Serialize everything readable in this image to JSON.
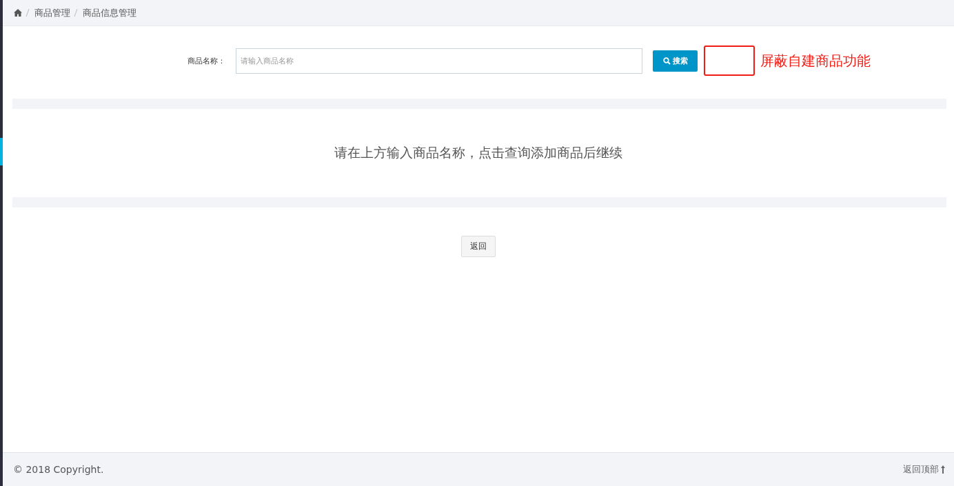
{
  "breadcrumb": [
    "商品管理",
    "商品信息管理"
  ],
  "search": {
    "label": "商品名称：",
    "placeholder": "请输入商品名称",
    "button": "搜索"
  },
  "annotation": {
    "text": "屏蔽自建商品功能"
  },
  "message": "请在上方输入商品名称，点击查询添加商品后继续",
  "back_button": "返回",
  "footer": {
    "copyright": "© 2018 Copyright.",
    "back_to_top": "返回顶部"
  }
}
